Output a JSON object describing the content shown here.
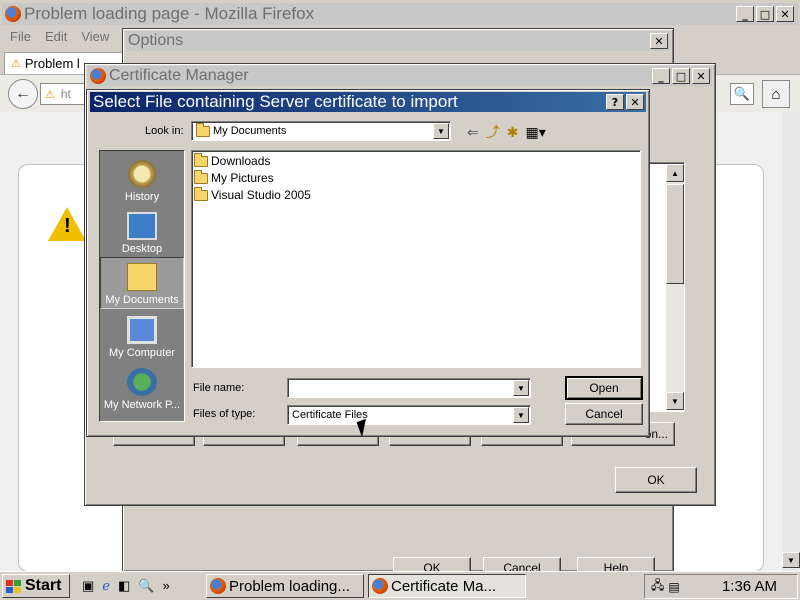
{
  "firefox": {
    "title": "Problem loading page - Mozilla Firefox",
    "menu": [
      "File",
      "Edit",
      "View"
    ],
    "tab_label": "Problem l",
    "url_fragment": "ht"
  },
  "options": {
    "title": "Options",
    "buttons": [
      "OK",
      "Cancel",
      "Help"
    ]
  },
  "cert_manager": {
    "title": "Certificate Manager",
    "ok_label": "OK",
    "partial_button": "on..."
  },
  "file_dialog": {
    "title": "Select File containing Server certificate to import",
    "help_glyph": "?",
    "close_glyph": "✕",
    "look_in_label": "Look in:",
    "look_in_value": "My Documents",
    "places": [
      "History",
      "Desktop",
      "My Documents",
      "My Computer",
      "My Network P..."
    ],
    "files": [
      "Downloads",
      "My Pictures",
      "Visual Studio 2005"
    ],
    "file_name_label": "File name:",
    "file_name_value": "",
    "file_type_label": "Files of type:",
    "file_type_value": "Certificate Files",
    "open_label": "Open",
    "cancel_label": "Cancel"
  },
  "taskbar": {
    "start_label": "Start",
    "chevron": "»",
    "tasks": [
      "Problem loading...",
      "Certificate Ma..."
    ],
    "clock": "1:36 AM"
  },
  "colors": {
    "titlebar_active": "#0a246a",
    "titlebar_inactive": "#c8c8c8",
    "face": "#d4d0c8",
    "places_bg": "#808080"
  }
}
